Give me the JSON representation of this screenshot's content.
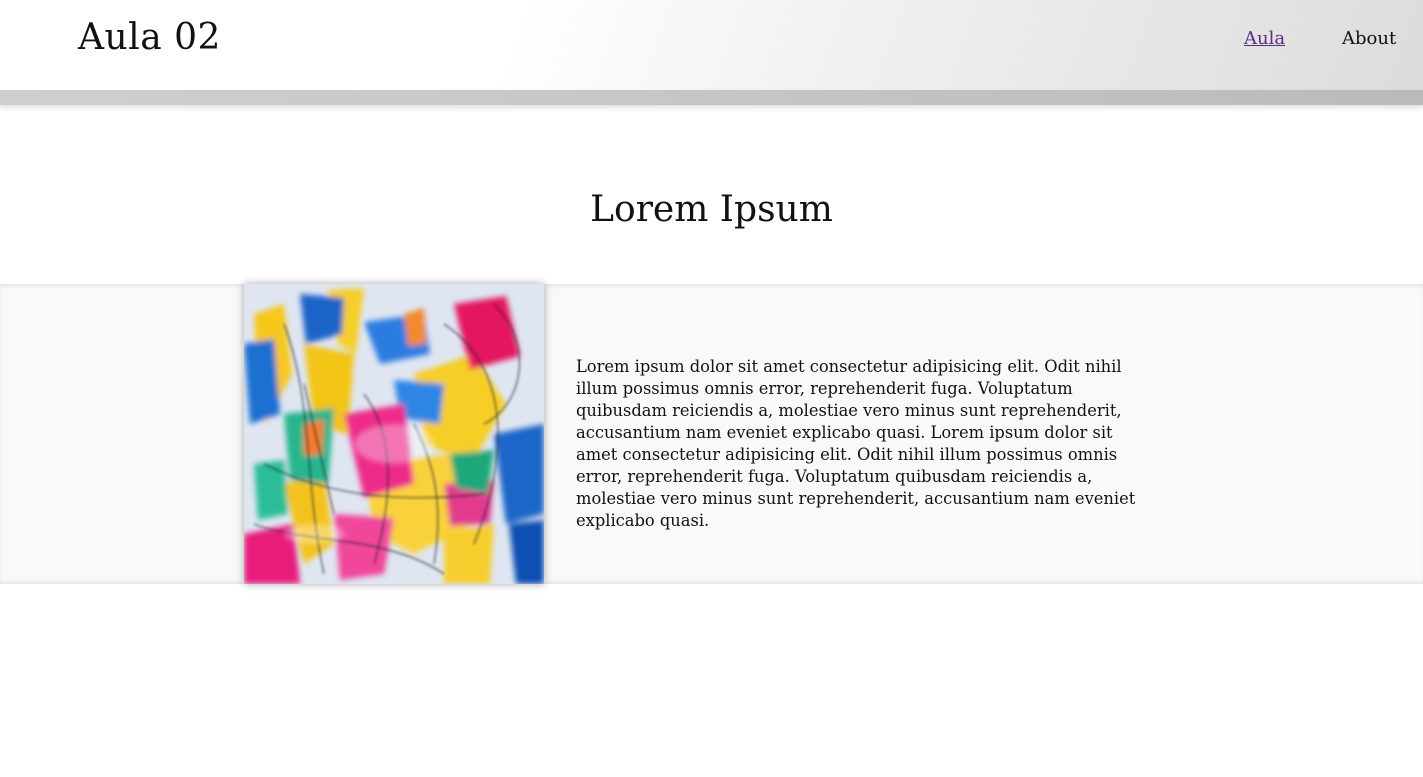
{
  "header": {
    "site_title": "Aula 02",
    "nav": [
      {
        "label": "Aula",
        "active": true
      },
      {
        "label": "About",
        "active": false
      }
    ]
  },
  "main": {
    "heading": "Lorem Ipsum",
    "image": {
      "description_icon": "abstract-painting-image"
    },
    "paragraph": "Lorem ipsum dolor sit amet consectetur adipisicing elit. Odit nihil illum possimus omnis error, reprehenderit fuga. Voluptatum quibusdam reiciendis a, molestiae vero minus sunt reprehenderit, accusantium nam eveniet explicabo quasi. Lorem ipsum dolor sit amet consectetur adipisicing elit. Odit nihil illum possimus omnis error, reprehenderit fuga. Voluptatum quibusdam reiciendis a, molestiae vero minus sunt reprehenderit, accusantium nam eveniet explicabo quasi."
  },
  "colors": {
    "active_link": "#5a2d82",
    "band_background": "#f9f9f9"
  }
}
